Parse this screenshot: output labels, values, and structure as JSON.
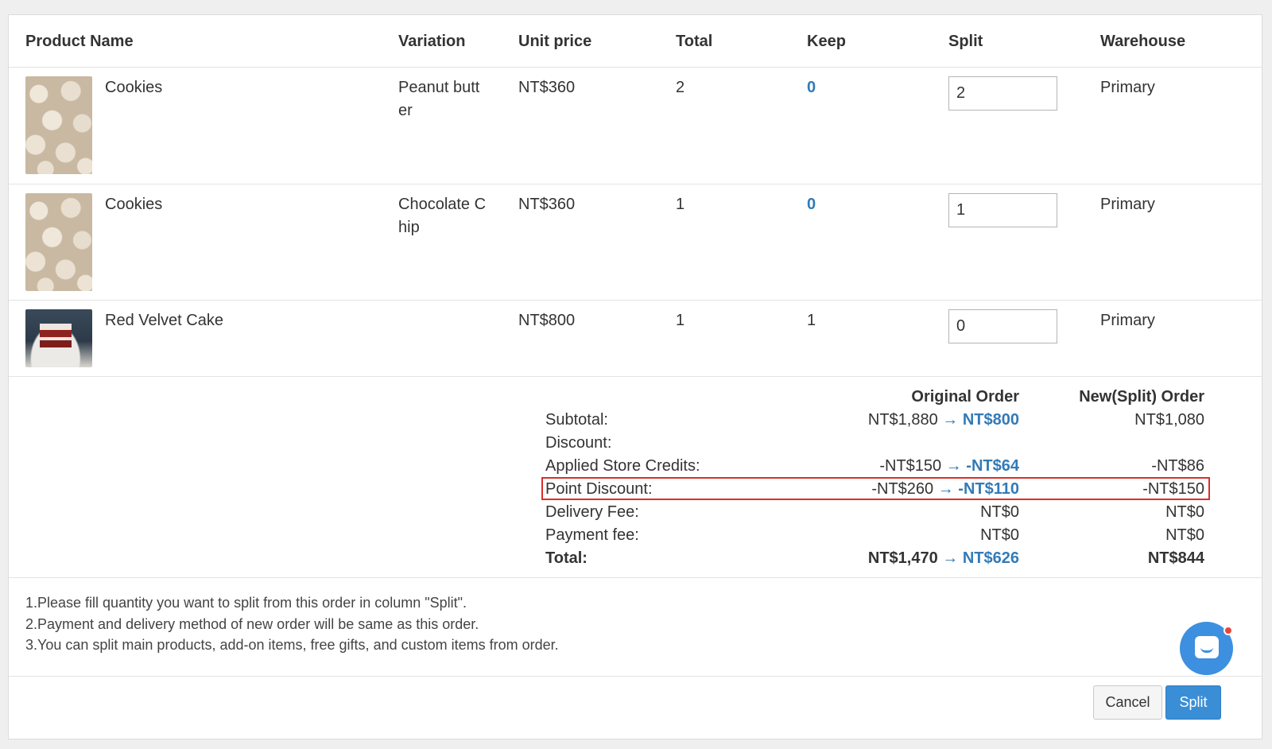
{
  "table": {
    "headers": [
      "Product Name",
      "Variation",
      "Unit price",
      "Total",
      "Keep",
      "Split",
      "Warehouse"
    ],
    "rows": [
      {
        "name": "Cookies",
        "variation_l1": "Peanut butt",
        "variation_l2": "er",
        "price": "NT$360",
        "total": "2",
        "keep": "0",
        "split": "2",
        "warehouse": "Primary",
        "image": "cookies-image"
      },
      {
        "name": "Cookies",
        "variation_l1": "Chocolate C",
        "variation_l2": "hip",
        "price": "NT$360",
        "total": "1",
        "keep": "0",
        "split": "1",
        "warehouse": "Primary",
        "image": "cookies-image"
      },
      {
        "name": "Red Velvet Cake",
        "variation_l1": "",
        "variation_l2": "",
        "price": "NT$800",
        "total": "1",
        "keep": "1",
        "split": "0",
        "warehouse": "Primary",
        "image": "cake-image"
      }
    ]
  },
  "summary": {
    "col_original": "Original Order",
    "col_new": "New(Split) Order",
    "arrow": "→",
    "lines": [
      {
        "label": "Subtotal:",
        "orig_from": "NT$1,880",
        "orig_to": "NT$800",
        "new": "NT$1,080"
      },
      {
        "label": "Discount:",
        "orig_from": "",
        "orig_to": "",
        "new": ""
      },
      {
        "label": "Applied Store Credits:",
        "orig_from": "-NT$150",
        "orig_to": "-NT$64",
        "new": "-NT$86"
      },
      {
        "label": "Point Discount:",
        "orig_from": "-NT$260",
        "orig_to": "-NT$110",
        "new": "-NT$150"
      },
      {
        "label": "Delivery Fee:",
        "orig_from": "",
        "orig_value": "NT$0",
        "new": "NT$0"
      },
      {
        "label": "Payment fee:",
        "orig_from": "",
        "orig_value": "NT$0",
        "new": "NT$0"
      },
      {
        "label": "Total:",
        "orig_from": "NT$1,470",
        "orig_to": "NT$626",
        "new": "NT$844"
      }
    ]
  },
  "notes": [
    "1.Please fill quantity you want to split from this order in column \"Split\".",
    "2.Payment and delivery method of new order will be same as this order.",
    "3.You can split main products, add-on items, free gifts, and custom items from order."
  ],
  "buttons": {
    "cancel": "Cancel",
    "split": "Split"
  },
  "colors": {
    "link_blue": "#337ab7",
    "highlight_red": "#d9302a",
    "primary_button": "#3a8ed6"
  }
}
